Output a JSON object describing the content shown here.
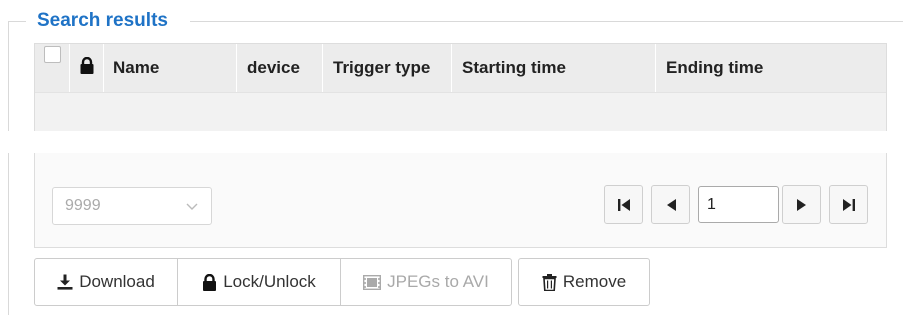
{
  "section": {
    "legend": "Search results"
  },
  "grid": {
    "columns": [
      "",
      "",
      "Name",
      "device",
      "Trigger type",
      "Starting time",
      "Ending time"
    ],
    "rows": []
  },
  "pager": {
    "page_size": "9999",
    "current_page": "1"
  },
  "actions": {
    "download_label": "Download",
    "lock_label": "Lock/Unlock",
    "jpegs_label": "JPEGs to AVI",
    "remove_label": "Remove"
  },
  "colors": {
    "accent": "#1f73c6",
    "header_bg": "#ececec",
    "disabled_text": "#a9a9a9"
  },
  "icons": {
    "lock": "lock-icon",
    "download": "download-icon",
    "film": "film-icon",
    "trash": "trash-icon",
    "first": "first-page-icon",
    "prev": "prev-page-icon",
    "next": "next-page-icon",
    "last": "last-page-icon"
  }
}
